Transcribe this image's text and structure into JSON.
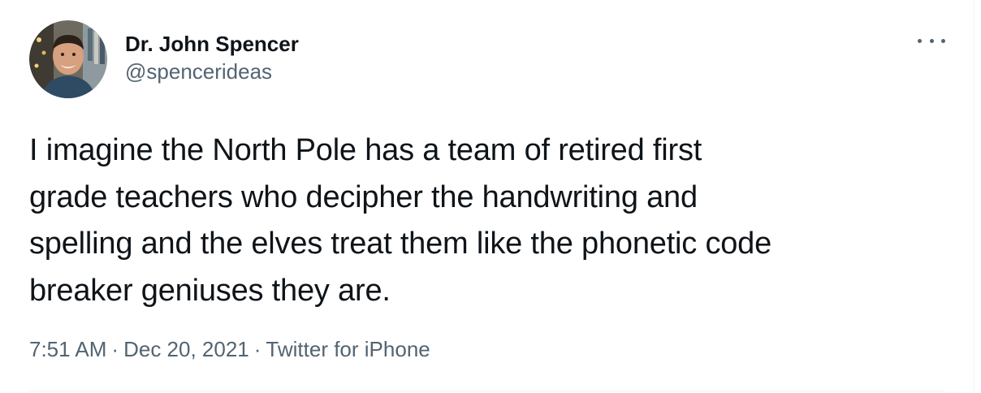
{
  "tweet": {
    "author": {
      "display_name": "Dr. John Spencer",
      "handle": "@spencerideas",
      "avatar_icon": "profile-photo"
    },
    "more_icon": "more-options-icon",
    "text_lines": [
      "I imagine the North Pole has a team of retired first",
      "grade teachers who decipher the handwriting and",
      "spelling and the elves treat them like the phonetic code",
      "breaker geniuses they are."
    ],
    "meta": {
      "time": "7:51 AM",
      "separator": "·",
      "date": "Dec 20, 2021",
      "source": "Twitter for iPhone"
    }
  },
  "colors": {
    "text": "#0f1419",
    "secondary": "#536471",
    "border": "#eff3f4"
  }
}
